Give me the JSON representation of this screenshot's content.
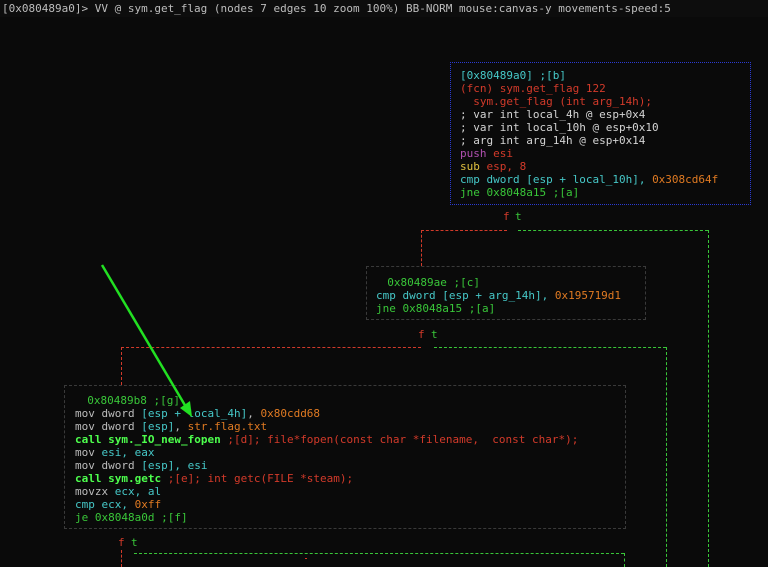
{
  "statusbar": {
    "text": "[0x080489a0]> VV @ sym.get_flag (nodes 7 edges 10 zoom 100%) BB-NORM mouse:canvas-y movements-speed:5"
  },
  "node_a": {
    "addr": "[0x80489a0] ;[b]",
    "fcn": "(fcn) sym.get_flag 122",
    "sig": "  sym.get_flag (int arg_14h);",
    "var1": "; var int local_4h @ esp+0x4",
    "var2": "; var int local_10h @ esp+0x10",
    "arg1": "; arg int arg_14h @ esp+0x14",
    "push_op": "push",
    "push_arg": " esi",
    "sub_op": "sub",
    "sub_arg": " esp, 8",
    "cmp_op": "cmp",
    "cmp_arg": " dword [esp + local_10h], ",
    "cmp_val": "0x308cd64f",
    "jne_op": "jne",
    "jne_arg": " 0x8048a15 ;[a]"
  },
  "node_c": {
    "addr": "  0x80489ae ;[c]",
    "cmp_op": "cmp",
    "cmp_arg": " dword [esp + arg_14h], ",
    "cmp_val": "0x195719d1",
    "jne_op": "jne",
    "jne_arg": " 0x8048a15 ;[a]"
  },
  "node_g": {
    "addr": "  0x80489b8 ;[g]",
    "l1_op": "mov",
    "l1_a": " dword ",
    "l1_b": "[esp + local_4h]",
    "l1_c": ", ",
    "l1_d": "0x80cdd68",
    "l2_op": "mov",
    "l2_a": " dword ",
    "l2_b": "[esp]",
    "l2_c": ", ",
    "l2_d": "str.flag.txt",
    "l3_op": "call",
    "l3_a": " sym._IO_new_fopen",
    "l3_b": " ;[d]; file*fopen(const char *filename,  const char*);",
    "l4_op": "mov",
    "l4_a": " esi, eax",
    "l5_op": "mov",
    "l5_a": " dword ",
    "l5_b": "[esp]",
    "l5_c": ", esi",
    "l6_op": "call",
    "l6_a": " sym.getc",
    "l6_b": " ;[e]; int getc(FILE *steam);",
    "l7_op": "movzx",
    "l7_a": " ecx, al",
    "l8_op": "cmp",
    "l8_a": " ecx, ",
    "l8_b": "0xff",
    "l9_op": "je",
    "l9_a": " 0x8048a0d ;[f]"
  },
  "edges": {
    "lbl_f": "f",
    "lbl_t": "t"
  },
  "colors": {
    "background": "#0a0a0a",
    "selected_border": "#2a3ad0",
    "true_edge": "#39c639",
    "false_edge": "#d23a2a",
    "plain_edge": "#3a3a3a",
    "arrow": "#22e022"
  }
}
